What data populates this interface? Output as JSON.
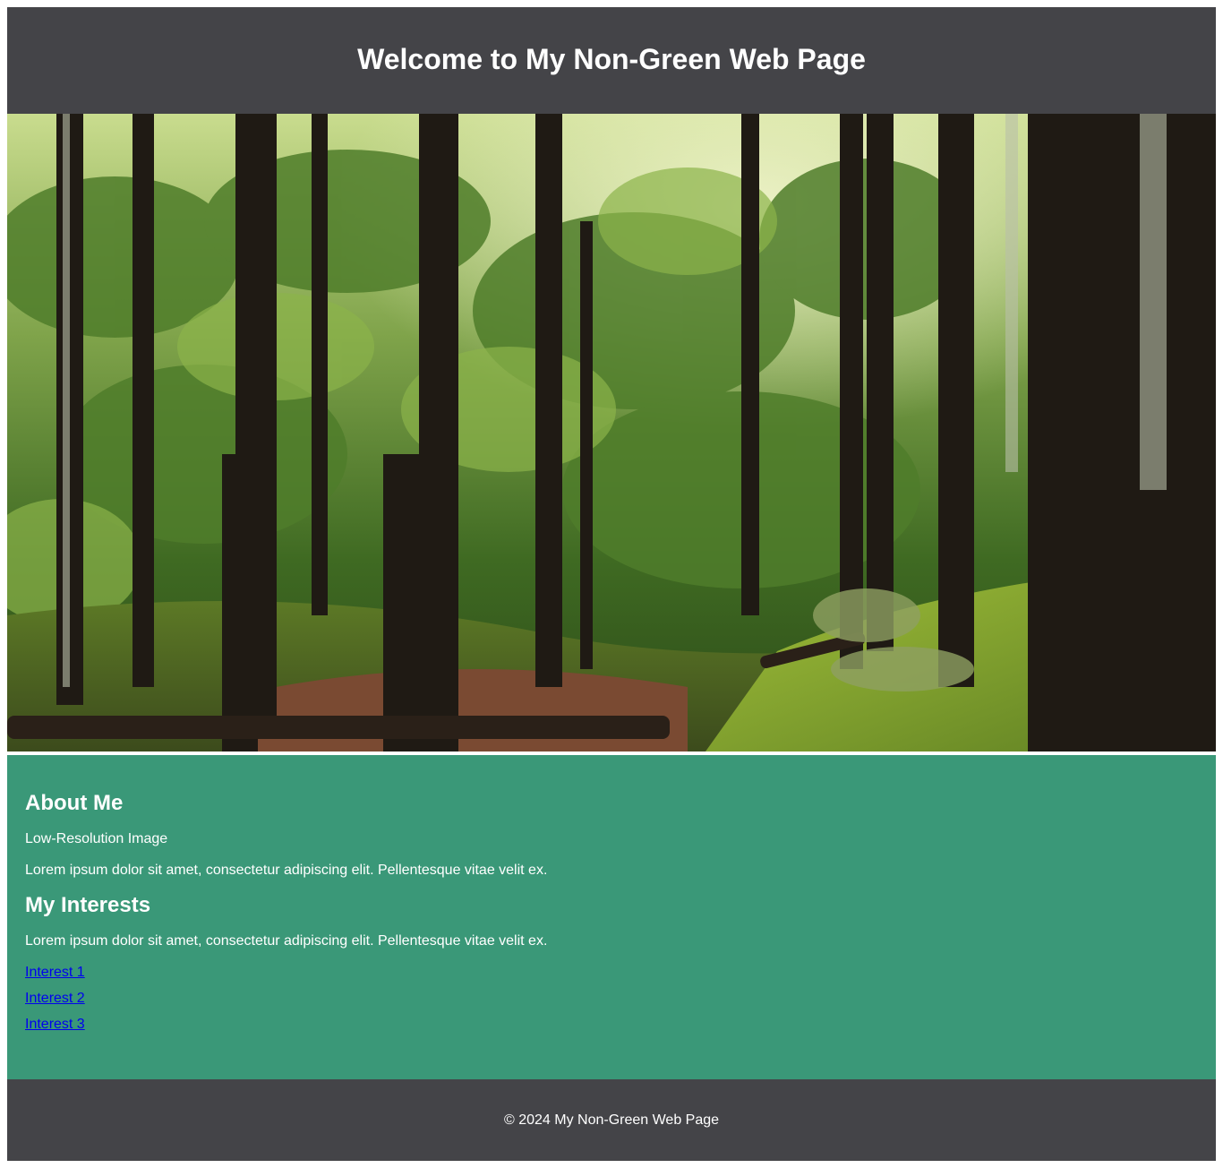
{
  "header": {
    "title": "Welcome to My Non-Green Web Page"
  },
  "hero": {
    "alt": "Forest scene with tall trees and mossy path"
  },
  "about": {
    "heading": "About Me",
    "image_text": "Low-Resolution Image",
    "body": "Lorem ipsum dolor sit amet, consectetur adipiscing elit. Pellentesque vitae velit ex."
  },
  "interests": {
    "heading": "My Interests",
    "body": "Lorem ipsum dolor sit amet, consectetur adipiscing elit. Pellentesque vitae velit ex.",
    "links": [
      "Interest 1",
      "Interest 2",
      "Interest 3"
    ]
  },
  "footer": {
    "text": "© 2024 My Non-Green Web Page"
  },
  "colors": {
    "header_bg": "#444448",
    "content_bg": "#3a9878",
    "link": "#0000ee"
  }
}
